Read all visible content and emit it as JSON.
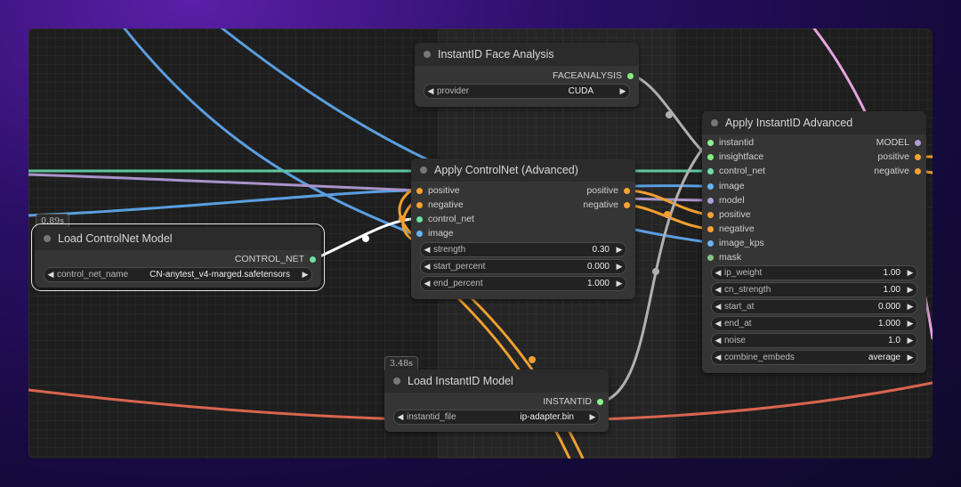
{
  "colors": {
    "pin_conditioning": "#f7a233",
    "pin_controlnet": "#6ee0a1",
    "pin_image": "#64b5f6",
    "pin_model": "#b39ddb",
    "pin_mask": "#81c784",
    "pin_instantid": "#8cf58c",
    "pin_faceanalysis": "#7ff07f",
    "wire_blue": "#5a9ee0",
    "wire_green": "#5fc7a0",
    "wire_purple": "#a893c9",
    "wire_orange": "#f0a030",
    "wire_white": "#ffffff",
    "wire_grey": "#b0b0b0",
    "wire_pink": "#e7a3e0",
    "wire_red": "#d8654f"
  },
  "face_analysis": {
    "title": "InstantID Face Analysis",
    "output": "FACEANALYSIS",
    "provider_label": "provider",
    "provider_value": "CUDA"
  },
  "apply_controlnet": {
    "title": "Apply ControlNet (Advanced)",
    "inputs": [
      "positive",
      "negative",
      "control_net",
      "image"
    ],
    "outputs": [
      "positive",
      "negative"
    ],
    "widgets": [
      {
        "name": "strength",
        "value": "0.30"
      },
      {
        "name": "start_percent",
        "value": "0.000"
      },
      {
        "name": "end_percent",
        "value": "1.000"
      }
    ]
  },
  "load_controlnet": {
    "time": "0.89s",
    "title": "Load ControlNet Model",
    "output": "CONTROL_NET",
    "widget_name": "control_net_name",
    "widget_value": "CN-anytest_v4-marged.safetensors"
  },
  "load_instantid": {
    "time": "3.48s",
    "title": "Load InstantID Model",
    "output": "INSTANTID",
    "widget_name": "instantid_file",
    "widget_value": "ip-adapter.bin"
  },
  "apply_instantid": {
    "title": "Apply InstantID Advanced",
    "inputs": [
      "instantid",
      "insightface",
      "control_net",
      "image",
      "model",
      "positive",
      "negative",
      "image_kps",
      "mask"
    ],
    "outputs": [
      "MODEL",
      "positive",
      "negative"
    ],
    "widgets": [
      {
        "name": "ip_weight",
        "value": "1.00"
      },
      {
        "name": "cn_strength",
        "value": "1.00"
      },
      {
        "name": "start_at",
        "value": "0.000"
      },
      {
        "name": "end_at",
        "value": "1.000"
      },
      {
        "name": "noise",
        "value": "1.0"
      },
      {
        "name": "combine_embeds",
        "value": "average"
      }
    ]
  }
}
